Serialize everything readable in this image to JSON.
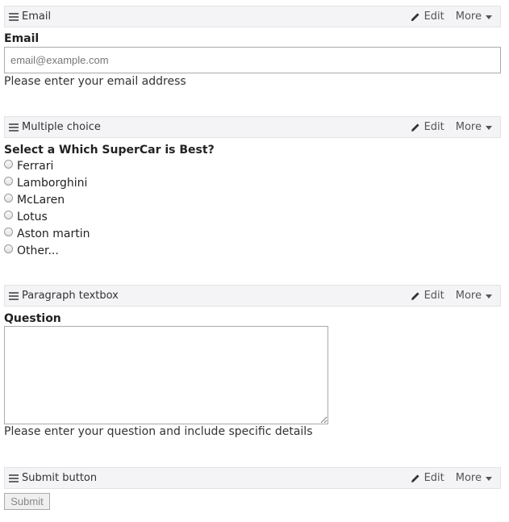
{
  "sections": {
    "email": {
      "bar_title": "Email",
      "edit_label": "Edit",
      "more_label": "More",
      "field_label": "Email",
      "placeholder": "email@example.com",
      "value": "",
      "help": "Please enter your email address"
    },
    "multiple_choice": {
      "bar_title": "Multiple choice",
      "edit_label": "Edit",
      "more_label": "More",
      "question": "Select a Which SuperCar is Best?",
      "options": [
        "Ferrari",
        "Lamborghini",
        "McLaren",
        "Lotus",
        "Aston martin",
        "Other..."
      ]
    },
    "paragraph": {
      "bar_title": "Paragraph textbox",
      "edit_label": "Edit",
      "more_label": "More",
      "field_label": "Question",
      "value": "",
      "help": "Please enter your question and include specific details"
    },
    "submit": {
      "bar_title": "Submit button",
      "edit_label": "Edit",
      "more_label": "More",
      "button_label": "Submit"
    }
  },
  "icons": {
    "handle": "drag-handle-icon",
    "edit": "pencil-icon",
    "more": "caret-down-icon"
  }
}
